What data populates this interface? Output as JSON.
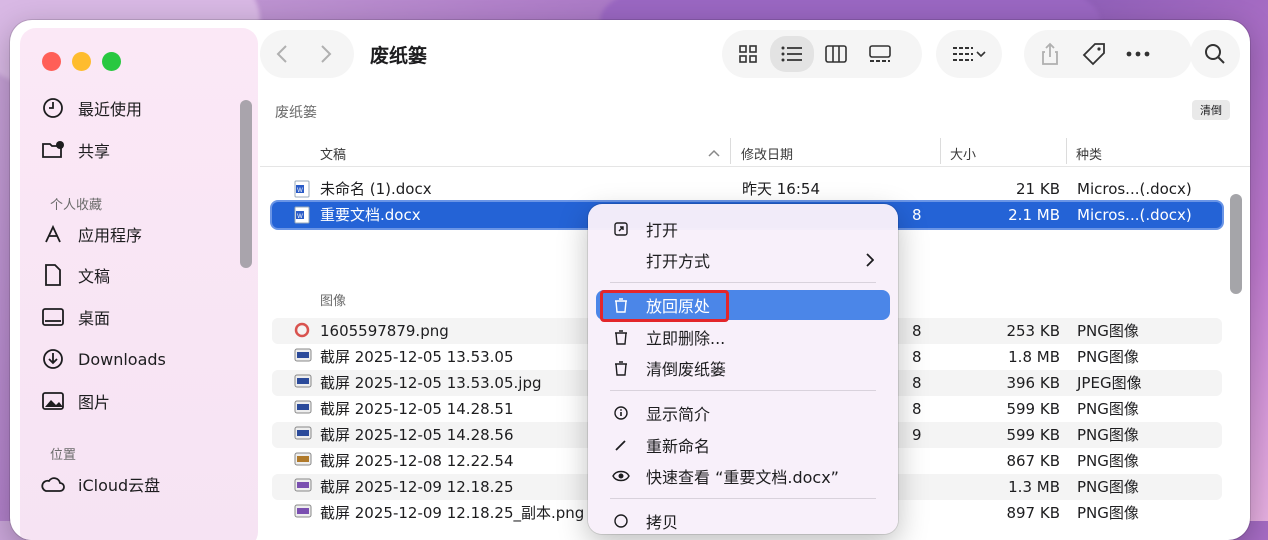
{
  "window": {
    "title": "废纸篓"
  },
  "sidebar": {
    "recents": "最近使用",
    "shared": "共享",
    "favorites_header": "个人收藏",
    "items": [
      {
        "label": "应用程序",
        "icon": "apps-icon"
      },
      {
        "label": "文稿",
        "icon": "document-icon"
      },
      {
        "label": "桌面",
        "icon": "desktop-icon"
      },
      {
        "label": "Downloads",
        "icon": "download-icon"
      },
      {
        "label": "图片",
        "icon": "photos-icon"
      }
    ],
    "locations_header": "位置",
    "icloud": "iCloud云盘"
  },
  "content": {
    "path_label": "废纸篓",
    "clear_label": "清倒",
    "columns": {
      "name": "文稿",
      "date": "修改日期",
      "size": "大小",
      "kind": "种类"
    },
    "docs": [
      {
        "name": "未命名 (1).docx",
        "date": "昨天 16:54",
        "size": "21 KB",
        "kind": "Micros...(.docx)"
      },
      {
        "name": "重要文档.docx",
        "date": "8",
        "size": "2.1 MB",
        "kind": "Micros...(.docx)"
      }
    ],
    "images_header": "图像",
    "images": [
      {
        "name": "1605597879.png",
        "date": "8",
        "size": "253 KB",
        "kind": "PNG图像"
      },
      {
        "name": "截屏 2025-12-05 13.53.05",
        "date": "8",
        "size": "1.8 MB",
        "kind": "PNG图像"
      },
      {
        "name": "截屏 2025-12-05 13.53.05.jpg",
        "date": "8",
        "size": "396 KB",
        "kind": "JPEG图像"
      },
      {
        "name": "截屏 2025-12-05 14.28.51",
        "date": "8",
        "size": "599 KB",
        "kind": "PNG图像"
      },
      {
        "name": "截屏 2025-12-05 14.28.56",
        "date": "9",
        "size": "599 KB",
        "kind": "PNG图像"
      },
      {
        "name": "截屏 2025-12-08 12.22.54",
        "date": "",
        "size": "867 KB",
        "kind": "PNG图像"
      },
      {
        "name": "截屏 2025-12-09 12.18.25",
        "date": "",
        "size": "1.3 MB",
        "kind": "PNG图像"
      },
      {
        "name": "截屏 2025-12-09 12.18.25_副本.png",
        "date": "",
        "size": "897 KB",
        "kind": "PNG图像"
      }
    ]
  },
  "menu": {
    "open": "打开",
    "open_with": "打开方式",
    "put_back": "放回原处",
    "delete_now": "立即删除...",
    "empty_trash": "清倒废纸篓",
    "get_info": "显示简介",
    "rename": "重新命名",
    "quick_look": "快速查看 “重要文档.docx”",
    "copy": "拷贝"
  },
  "colors": {
    "accent": "#2463d6",
    "highlight_box": "#e3262a"
  }
}
